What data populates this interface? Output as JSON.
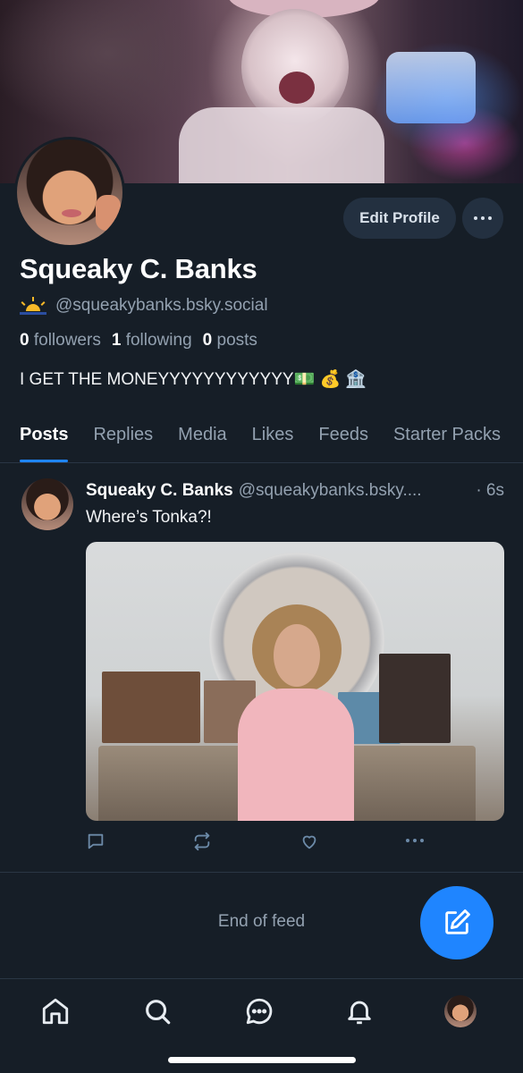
{
  "profile": {
    "display_name": "Squeaky C. Banks",
    "handle": "@squeakybanks.bsky.social",
    "followers_count": "0",
    "followers_label": "followers",
    "following_count": "1",
    "following_label": "following",
    "posts_count": "0",
    "posts_label": "posts",
    "bio": "I GET THE MONEYYYYYYYYYYYY💵 💰 🏦",
    "edit_label": "Edit Profile"
  },
  "tabs": [
    {
      "label": "Posts",
      "active": true
    },
    {
      "label": "Replies"
    },
    {
      "label": "Media"
    },
    {
      "label": "Likes"
    },
    {
      "label": "Feeds"
    },
    {
      "label": "Starter Packs"
    }
  ],
  "post": {
    "author": "Squeaky C. Banks",
    "handle": "@squeakybanks.bsky....",
    "time": "· 6s",
    "text": "Where’s Tonka?!"
  },
  "feed": {
    "end_label": "End of feed"
  },
  "colors": {
    "accent": "#1f85ff",
    "background": "#161e27",
    "muted_text": "#93a1b0"
  },
  "icons": {
    "post_actions": [
      "reply-icon",
      "repost-icon",
      "like-icon",
      "more-icon"
    ],
    "bottom_nav": [
      "home-icon",
      "search-icon",
      "chat-icon",
      "bell-icon",
      "avatar"
    ],
    "fab": "compose-icon"
  }
}
